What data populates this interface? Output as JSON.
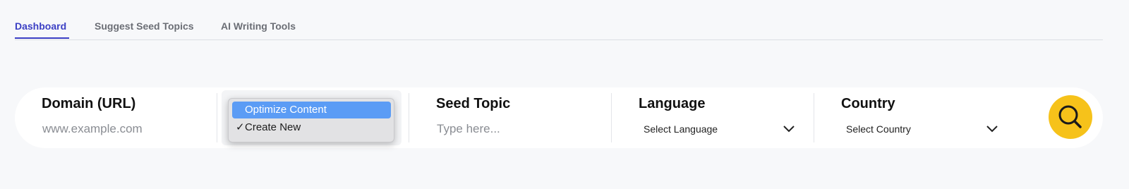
{
  "tabs": [
    {
      "label": "Dashboard",
      "active": true
    },
    {
      "label": "Suggest Seed Topics",
      "active": false
    },
    {
      "label": "AI Writing Tools",
      "active": false
    }
  ],
  "search_bar": {
    "domain": {
      "label": "Domain (URL)",
      "placeholder": "www.example.com"
    },
    "mode_menu": {
      "options": [
        {
          "label": "Optimize Content",
          "highlighted": true,
          "checked": false
        },
        {
          "label": "Create New",
          "highlighted": false,
          "checked": true
        }
      ],
      "check_mark": "✓"
    },
    "seed_topic": {
      "label": "Seed Topic",
      "placeholder": "Type here..."
    },
    "language": {
      "label": "Language",
      "value": "Select Language"
    },
    "country": {
      "label": "Country",
      "value": "Select Country"
    },
    "search_button": {
      "icon": "search-icon"
    }
  },
  "colors": {
    "accent": "#3b3fc4",
    "search_button": "#f6c21a",
    "menu_highlight": "#5b9cf5",
    "background": "#f7f8fa"
  }
}
